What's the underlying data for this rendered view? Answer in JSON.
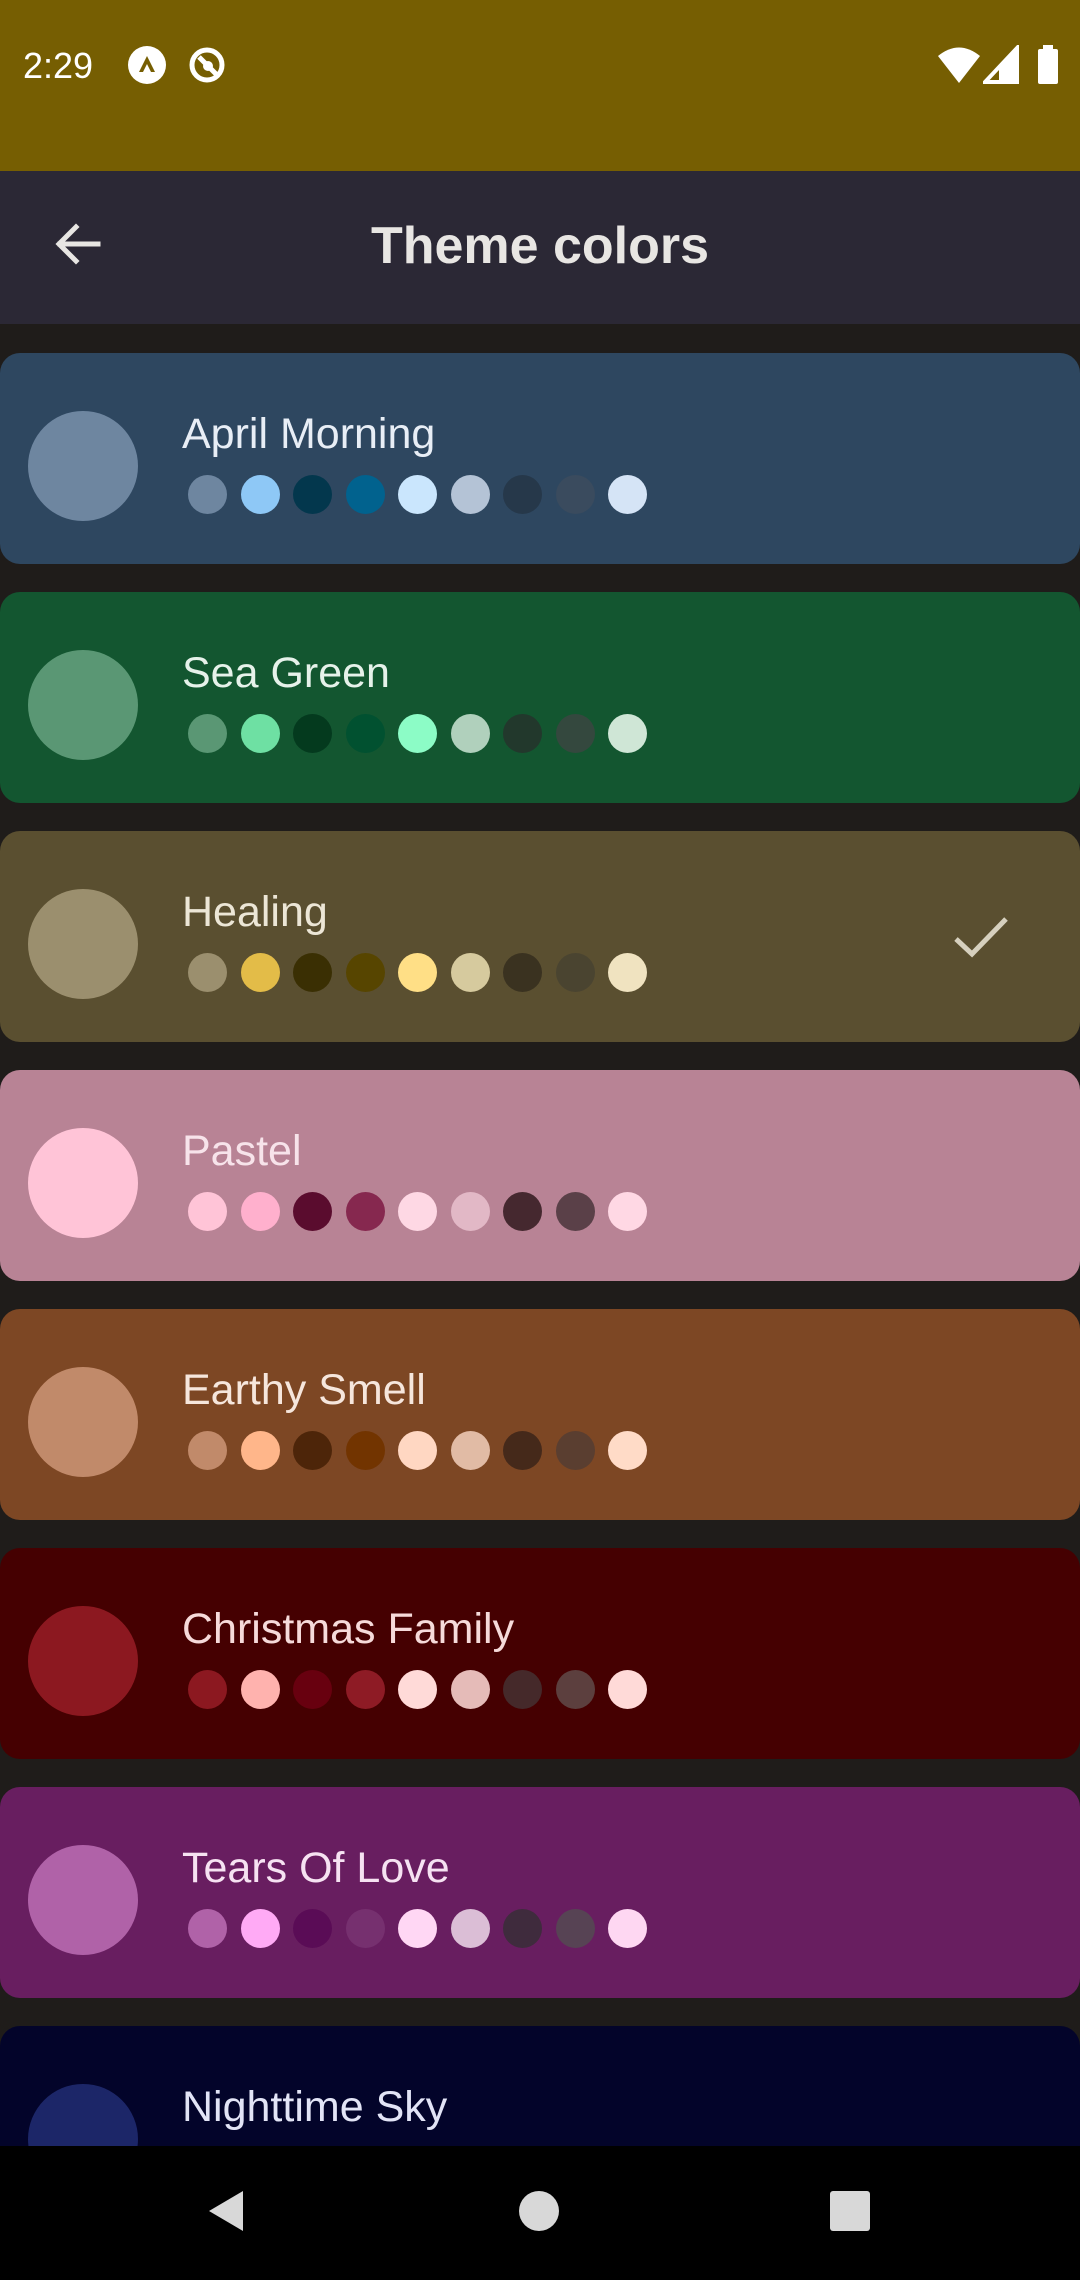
{
  "status_bar": {
    "time": "2:29",
    "icons": [
      "app-notification-icon",
      "circle-slash-icon",
      "wifi-icon",
      "signal-icon",
      "battery-icon"
    ]
  },
  "app_bar": {
    "title": "Theme colors",
    "back_icon": "arrow-left-icon"
  },
  "themes": [
    {
      "name": "April Morning",
      "background": "#2e4760",
      "text_color": "#e8eef6",
      "primary": "#6e86a0",
      "selected": false,
      "swatches": [
        "#6e86a0",
        "#8ec8f6",
        "#03374d",
        "#01628e",
        "#cae6fd",
        "#b4c3d6",
        "#26384a",
        "#3a4b5e",
        "#d5e4f6"
      ]
    },
    {
      "name": "Sea Green",
      "background": "#135630",
      "text_color": "#e6f2ea",
      "primary": "#5a9774",
      "selected": false,
      "swatches": [
        "#5a9774",
        "#6ee0a3",
        "#043a1e",
        "#015130",
        "#8cfcc6",
        "#b0d0bc",
        "#22382c",
        "#34483e",
        "#cfe6d6"
      ]
    },
    {
      "name": "Healing",
      "background": "#5a4f30",
      "text_color": "#ece6d6",
      "primary": "#9b8f6e",
      "selected": true,
      "swatches": [
        "#9b8f6e",
        "#e3bc48",
        "#3a2f03",
        "#574500",
        "#ffdf86",
        "#d6ca9e",
        "#3a3220",
        "#4a4430",
        "#f0e3c0"
      ]
    },
    {
      "name": "Pastel",
      "background": "#b88395",
      "text_color": "#f7e3ea",
      "primary": "#ffc4d7",
      "selected": false,
      "swatches": [
        "#ffc4d7",
        "#ffb0cd",
        "#5a0c2e",
        "#86284f",
        "#fed8e4",
        "#e2b8c6",
        "#45282f",
        "#5a4048",
        "#ffd8e4"
      ]
    },
    {
      "name": "Earthy Smell",
      "background": "#7d4724",
      "text_color": "#f6e6dc",
      "primary": "#c18a6a",
      "selected": false,
      "swatches": [
        "#c18a6a",
        "#ffb68a",
        "#4d2509",
        "#723400",
        "#ffd7c2",
        "#e1bba5",
        "#45291a",
        "#5a3e30",
        "#ffdbc7"
      ]
    },
    {
      "name": "Christmas Family",
      "background": "#450001",
      "text_color": "#f6dada",
      "primary": "#8c1820",
      "selected": false,
      "swatches": [
        "#8c1820",
        "#ffb2ae",
        "#68000f",
        "#8e1b25",
        "#ffdad8",
        "#e5bbb8",
        "#45292a",
        "#5c3f3e",
        "#ffdad8"
      ]
    },
    {
      "name": "Tears Of Love",
      "background": "#681e60",
      "text_color": "#f6e2f2",
      "primary": "#b062a8",
      "selected": false,
      "swatches": [
        "#b062a8",
        "#ffaaf5",
        "#5a0c56",
        "#76306f",
        "#ffd7f4",
        "#dbbed6",
        "#3f2b3d",
        "#574354",
        "#fed7f2"
      ]
    },
    {
      "name": "Nighttime Sky",
      "background": "#03042a",
      "text_color": "#e2e4f6",
      "primary": "#1c2668",
      "selected": false,
      "swatches": []
    }
  ],
  "nav_bar": {
    "icons": [
      "back-triangle-icon",
      "home-circle-icon",
      "recents-square-icon"
    ]
  }
}
